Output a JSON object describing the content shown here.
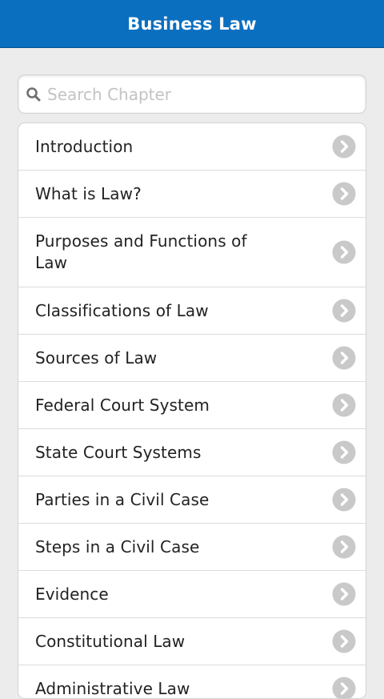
{
  "header": {
    "title": "Business Law"
  },
  "search": {
    "placeholder": "Search Chapter",
    "icon": "search-icon"
  },
  "chapters": [
    {
      "label": "Introduction"
    },
    {
      "label": "What is Law?"
    },
    {
      "label": "Purposes and Functions of Law"
    },
    {
      "label": "Classifications of Law"
    },
    {
      "label": "Sources of Law"
    },
    {
      "label": "Federal Court System"
    },
    {
      "label": "State Court Systems"
    },
    {
      "label": "Parties in a Civil Case"
    },
    {
      "label": "Steps in a Civil Case"
    },
    {
      "label": "Evidence"
    },
    {
      "label": "Constitutional Law"
    },
    {
      "label": "Administrative Law"
    }
  ],
  "colors": {
    "header_bg": "#0b6fc0",
    "chevron": "#c9c9c9",
    "background": "#ececec"
  }
}
